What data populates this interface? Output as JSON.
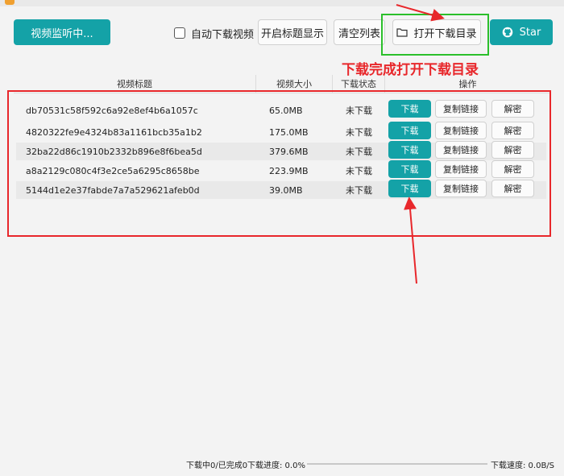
{
  "toolbar": {
    "monitor_label": "视频监听中...",
    "auto_download_label": "自动下载视频",
    "title_toggle_label": "开启标题显示",
    "clear_list_label": "清空列表",
    "open_dir_label": "打开下载目录",
    "star_label": "Star",
    "accent_color": "#14a2a7"
  },
  "annotation": {
    "note": "下载完成打开下载目录",
    "color": "#e8272b"
  },
  "table": {
    "columns": [
      "视频标题",
      "视频大小",
      "下载状态",
      "操作"
    ],
    "rows": [
      {
        "title": "db70531c58f592c6a92e8ef4b6a1057c",
        "size": "65.0MB",
        "status": "未下载",
        "download": "下载",
        "copy": "复制链接",
        "decrypt": "解密"
      },
      {
        "title": "4820322fe9e4324b83a1161bcb35a1b2",
        "size": "175.0MB",
        "status": "未下载",
        "download": "下载",
        "copy": "复制链接",
        "decrypt": "解密"
      },
      {
        "title": "32ba22d86c1910b2332b896e8f6bea5d",
        "size": "379.6MB",
        "status": "未下载",
        "download": "下载",
        "copy": "复制链接",
        "decrypt": "解密"
      },
      {
        "title": "a8a2129c080c4f3e2ce5a6295c8658be",
        "size": "223.9MB",
        "status": "未下载",
        "download": "下载",
        "copy": "复制链接",
        "decrypt": "解密"
      },
      {
        "title": "5144d1e2e37fabde7a7a529621afeb0d",
        "size": "39.0MB",
        "status": "未下载",
        "download": "下载",
        "copy": "复制链接",
        "decrypt": "解密"
      }
    ]
  },
  "statusbar": {
    "counts": "下载中0/已完成0",
    "progress_label": "下载进度: 0.0%",
    "progress_value": 0,
    "speed_label": "下载速度: 0.0B/S"
  }
}
